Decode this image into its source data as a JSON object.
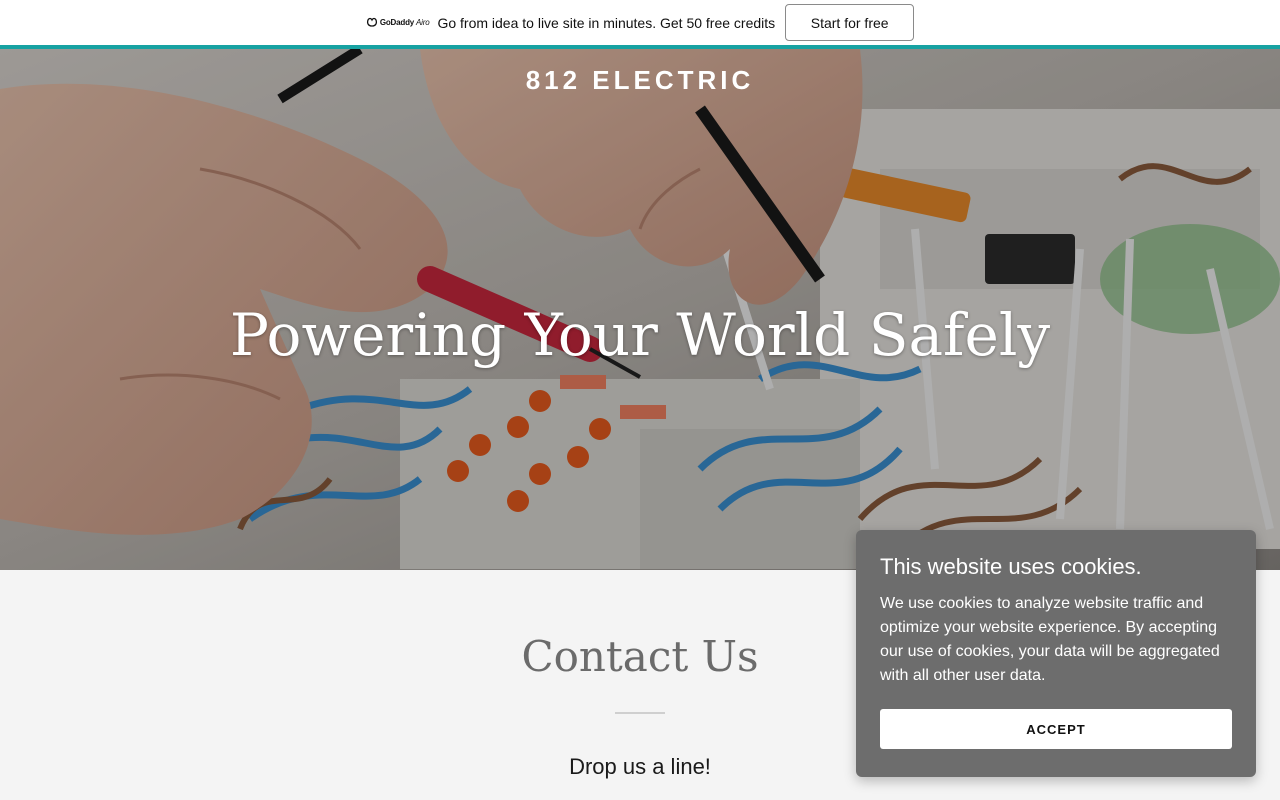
{
  "promo": {
    "logo_text": "GoDaddy",
    "logo_suffix": "Airo",
    "message": "Go from idea to live site in minutes. Get 50 free credits",
    "cta_label": "Start for free"
  },
  "hero": {
    "brand": "812 ELECTRIC",
    "title": "Powering Your World Safely"
  },
  "contact": {
    "title": "Contact Us",
    "subtitle": "Drop us a line!"
  },
  "cookie": {
    "title": "This website uses cookies.",
    "body": "We use cookies to analyze website traffic and optimize your website experience. By accepting our use of cookies, your data will be aggregated with all other user data.",
    "accept_label": "ACCEPT"
  },
  "colors": {
    "accent": "#17a2a2",
    "cookie_bg": "#6d6d6d"
  }
}
